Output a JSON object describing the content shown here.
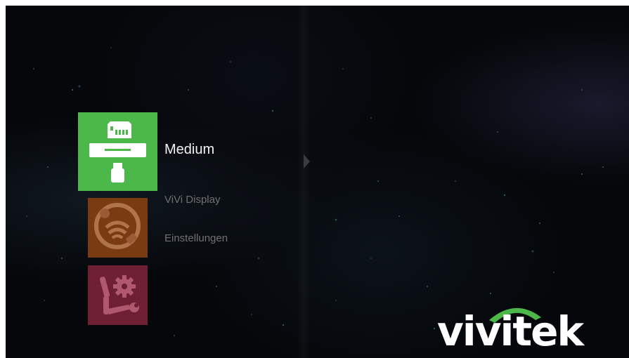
{
  "menu": {
    "items": [
      {
        "label": "Medium",
        "icon": "media-storage-icon",
        "color": "#4cb84a",
        "selected": true
      },
      {
        "label": "ViVi Display",
        "icon": "wireless-display-icon",
        "color": "#7a3a12",
        "selected": false
      },
      {
        "label": "Einstellungen",
        "icon": "settings-tools-icon",
        "color": "#6e1f33",
        "selected": false
      }
    ]
  },
  "brand": {
    "logo_text": "vivitek",
    "arc_color": "#4cb84a"
  }
}
